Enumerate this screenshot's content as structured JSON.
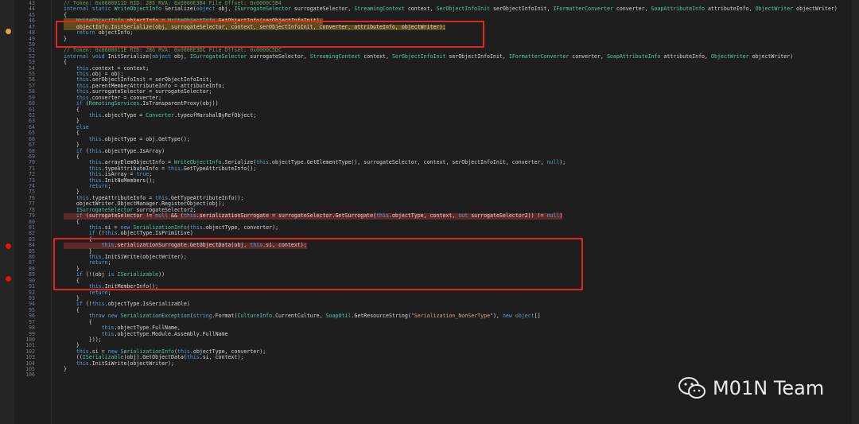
{
  "lines": [
    {
      "n": "43",
      "t": "// Token: 0x0600011D RID: 285 RVA: 0x0000E3B4 File Offset: 0x0000C5B4"
    },
    {
      "n": "44",
      "t": "internal static WriteObjectInfo Serialize(object obj, ISurrogateSelector surrogateSelector, StreamingContext context, SerObjectInfoInit serObjectInfoInit, IFormatterConverter converter, SoapAttributeInfo attributeInfo, ObjectWriter objectWriter)"
    },
    {
      "n": "45",
      "t": "{"
    },
    {
      "n": "46",
      "t": "    WriteObjectInfo objectInfo = WriteObjectInfo.GetObjectInfo(serObjectInfoInit);"
    },
    {
      "n": "47",
      "t": "    objectInfo.InitSerialize(obj, surrogateSelector, context, serObjectInfoInit, converter, attributeInfo, objectWriter);"
    },
    {
      "n": "48",
      "t": "    return objectInfo;"
    },
    {
      "n": "49",
      "t": "}"
    },
    {
      "n": "50",
      "t": ""
    },
    {
      "n": "51",
      "t": "// Token: 0x0600011E RID: 286 RVA: 0x0000E3DC File Offset: 0x0000C5DC"
    },
    {
      "n": "52",
      "t": "internal void InitSerialize(object obj, ISurrogateSelector surrogateSelector, StreamingContext context, SerObjectInfoInit serObjectInfoInit, IFormatterConverter converter, SoapAttributeInfo attributeInfo, ObjectWriter objectWriter)"
    },
    {
      "n": "53",
      "t": "{"
    },
    {
      "n": "54",
      "t": "    this.context = context;"
    },
    {
      "n": "55",
      "t": "    this.obj = obj;"
    },
    {
      "n": "56",
      "t": "    this.serObjectInfoInit = serObjectInfoInit;"
    },
    {
      "n": "57",
      "t": "    this.parentMemberAttributeInfo = attributeInfo;"
    },
    {
      "n": "58",
      "t": "    this.surrogateSelector = surrogateSelector;"
    },
    {
      "n": "59",
      "t": "    this.converter = converter;"
    },
    {
      "n": "60",
      "t": "    if (RemotingServices.IsTransparentProxy(obj))"
    },
    {
      "n": "61",
      "t": "    {"
    },
    {
      "n": "62",
      "t": "        this.objectType = Converter.typeofMarshalByRefObject;"
    },
    {
      "n": "63",
      "t": "    }"
    },
    {
      "n": "64",
      "t": "    else"
    },
    {
      "n": "65",
      "t": "    {"
    },
    {
      "n": "66",
      "t": "        this.objectType = obj.GetType();"
    },
    {
      "n": "67",
      "t": "    }"
    },
    {
      "n": "68",
      "t": "    if (this.objectType.IsArray)"
    },
    {
      "n": "69",
      "t": "    {"
    },
    {
      "n": "70",
      "t": "        this.arrayElemObjectInfo = WriteObjectInfo.Serialize(this.objectType.GetElementType(), surrogateSelector, context, serObjectInfoInit, converter, null);"
    },
    {
      "n": "71",
      "t": "        this.typeAttributeInfo = this.GetTypeAttributeInfo();"
    },
    {
      "n": "72",
      "t": "        this.isArray = true;"
    },
    {
      "n": "73",
      "t": "        this.InitNoMembers();"
    },
    {
      "n": "74",
      "t": "        return;"
    },
    {
      "n": "75",
      "t": "    }"
    },
    {
      "n": "76",
      "t": "    this.typeAttributeInfo = this.GetTypeAttributeInfo();"
    },
    {
      "n": "77",
      "t": "    objectWriter.ObjectManager.RegisterObject(obj);"
    },
    {
      "n": "78",
      "t": "    ISurrogateSelector surrogateSelector2;"
    },
    {
      "n": "79",
      "t": "    if (surrogateSelector != null && (this.serializationSurrogate = surrogateSelector.GetSurrogate(this.objectType, context, out surrogateSelector2)) != null)"
    },
    {
      "n": "80",
      "t": "    {"
    },
    {
      "n": "81",
      "t": "        this.si = new SerializationInfo(this.objectType, converter);"
    },
    {
      "n": "82",
      "t": "        if (!this.objectType.IsPrimitive)"
    },
    {
      "n": "83",
      "t": "        {"
    },
    {
      "n": "84",
      "t": "            this.serializationSurrogate.GetObjectData(obj, this.si, context);"
    },
    {
      "n": "85",
      "t": "        }"
    },
    {
      "n": "86",
      "t": "        this.InitSiWrite(objectWriter);"
    },
    {
      "n": "87",
      "t": "        return;"
    },
    {
      "n": "88",
      "t": "    }"
    },
    {
      "n": "89",
      "t": "    if (!(obj is ISerializable))"
    },
    {
      "n": "90",
      "t": "    {"
    },
    {
      "n": "91",
      "t": "        this.InitMemberInfo();"
    },
    {
      "n": "92",
      "t": "        return;"
    },
    {
      "n": "93",
      "t": "    }"
    },
    {
      "n": "94",
      "t": "    if (!this.objectType.IsSerializable)"
    },
    {
      "n": "95",
      "t": "    {"
    },
    {
      "n": "96",
      "t": "        throw new SerializationException(string.Format(CultureInfo.CurrentCulture, SoapUtil.GetResourceString(\"Serialization_NonSerType\"), new object[]"
    },
    {
      "n": "97",
      "t": "        {"
    },
    {
      "n": "98",
      "t": "            this.objectType.FullName,"
    },
    {
      "n": "99",
      "t": "            this.objectType.Module.Assembly.FullName"
    },
    {
      "n": "100",
      "t": "        }));"
    },
    {
      "n": "101",
      "t": "    }"
    },
    {
      "n": "102",
      "t": "    this.si = new SerializationInfo(this.objectType, converter);"
    },
    {
      "n": "103",
      "t": "    ((ISerializable)obj).GetObjectData(this.si, context);"
    },
    {
      "n": "104",
      "t": "    this.InitSiWrite(objectWriter);"
    },
    {
      "n": "105",
      "t": "}"
    },
    {
      "n": "106",
      "t": ""
    }
  ],
  "watermark": {
    "text": "M01N Team",
    "icon": "wechat-icon"
  },
  "colors": {
    "background": "#1e1e1e",
    "highlight_box": "#e0261e",
    "breakpoint": "#e51400",
    "keyword": "#569cd6",
    "type": "#4ec9b0",
    "comment": "#6a9955"
  }
}
